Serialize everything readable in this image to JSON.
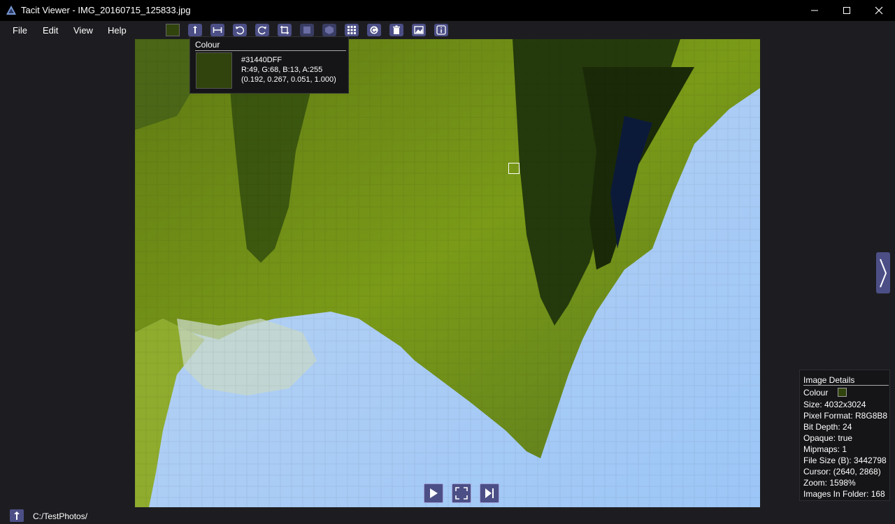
{
  "window": {
    "title": "Tacit Viewer - IMG_20160715_125833.jpg",
    "minimize_glyph": "—",
    "maximize_glyph": "☐",
    "close_glyph": "✕"
  },
  "menu": {
    "items": [
      "File",
      "Edit",
      "View",
      "Help"
    ]
  },
  "toolbar": {
    "tools": [
      "colour-swatch",
      "pixel-editor-icon",
      "resize-icon",
      "rotate-ccw-icon",
      "rotate-cw-icon",
      "crop-icon",
      "tile-icon",
      "multi-frame-icon",
      "grid-icon",
      "refresh-icon",
      "delete-icon",
      "image-open-icon",
      "info-icon"
    ]
  },
  "colour_popup": {
    "heading": "Colour",
    "hex": "#31440DFF",
    "rgba": "R:49, G:68, B:13, A:255",
    "normalized": "(0.192, 0.267, 0.051, 1.000)",
    "swatch_color": "#31440D"
  },
  "image_details": {
    "heading": "Image Details",
    "colour_label": "Colour",
    "rows": [
      "Size: 4032x3024",
      "Pixel Format: R8G8B8",
      "Bit Depth: 24",
      "Opaque: true",
      "Mipmaps: 1",
      "File Size (B): 3442798",
      "Cursor: (2640, 2868)",
      "Zoom: 1598%",
      "Images In Folder: 168"
    ]
  },
  "playback": {
    "controls": [
      "play-icon",
      "fullscreen-icon",
      "skip-end-icon"
    ]
  },
  "status": {
    "path": "C:/TestPhotos/"
  },
  "colors": {
    "accent": "#4c4f86",
    "background": "#1d1d21",
    "sampled": "#31440D"
  }
}
